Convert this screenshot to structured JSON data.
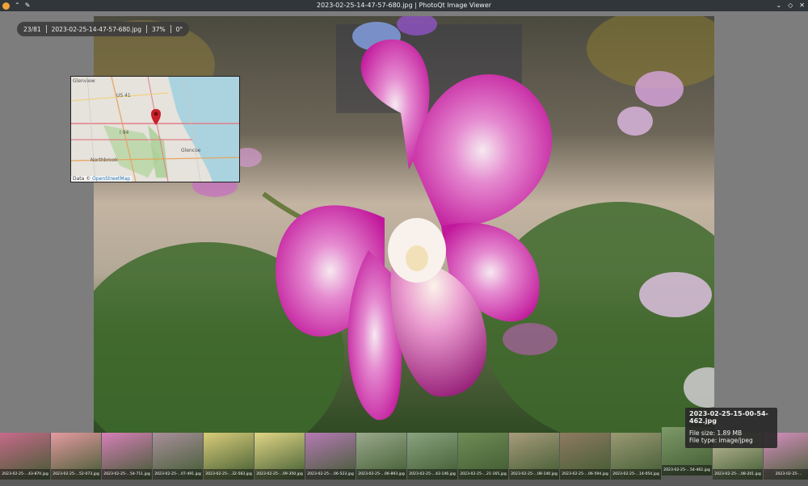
{
  "window": {
    "title": "2023-02-25-14-47-57-680.jpg | PhotoQt Image Viewer",
    "controls": [
      "chevron-down",
      "restore",
      "close"
    ]
  },
  "info_pill": {
    "counter": "23/81",
    "filename": "2023-02-25-14-47-57-680.jpg",
    "zoom": "37%",
    "rotation": "0°"
  },
  "map": {
    "labels": {
      "highway1": "US 41",
      "highway2": "I 94",
      "town1": "Northbrook",
      "town2": "Glencoe",
      "town3": "Glenview"
    },
    "attribution_prefix": "Data © ",
    "attribution_link": "OpenStreetMap"
  },
  "thumbnails": [
    {
      "caption": "2023-02-25-...43-870.jpg",
      "color": "#c76a8a"
    },
    {
      "caption": "2023-02-25-...52-073.jpg",
      "color": "#e59aa0"
    },
    {
      "caption": "2023-02-25-...54-711.jpg",
      "color": "#d77fb8"
    },
    {
      "caption": "2023-02-25-...07-491.jpg",
      "color": "#a98f9b"
    },
    {
      "caption": "2023-02-25-...32-583.jpg",
      "color": "#d9cc7a"
    },
    {
      "caption": "2023-02-25-...09-350.jpg",
      "color": "#e1d686"
    },
    {
      "caption": "2023-02-25-...06-523.jpg",
      "color": "#b67ab5"
    },
    {
      "caption": "2023-02-25-...06-893.jpg",
      "color": "#9aa98c"
    },
    {
      "caption": "2023-02-25-...43-146.jpg",
      "color": "#8aa380"
    },
    {
      "caption": "2023-02-25-...21-165.jpg",
      "color": "#6f8c56"
    },
    {
      "caption": "2023-02-25-...08-140.jpg",
      "color": "#a89b7a"
    },
    {
      "caption": "2023-02-25-...06-594.jpg",
      "color": "#8f7a62"
    },
    {
      "caption": "2023-02-25-...14-054.jpg",
      "color": "#9b9a74"
    },
    {
      "caption": "2023-02-25-...54-462.jpg",
      "color": "#7f9a68",
      "active": true
    },
    {
      "caption": "2023-02-25-...08-201.jpg",
      "color": "#c8c2a2"
    },
    {
      "caption": "2023-02-25-...",
      "color": "#d88fc0"
    }
  ],
  "tooltip": {
    "name": "2023-02-25-15-00-54-462.jpg",
    "size": "File size: 1.89 MB",
    "type": "File type: image/jpeg"
  }
}
